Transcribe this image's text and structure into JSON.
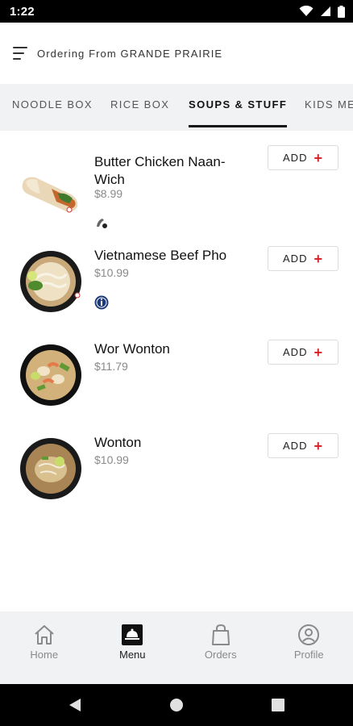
{
  "status_bar": {
    "time": "1:22",
    "icons": [
      "wifi-icon",
      "signal-icon",
      "battery-icon"
    ]
  },
  "header": {
    "menu_icon": "menu-icon",
    "title": "Ordering From GRANDE PRAIRIE"
  },
  "tabs": [
    {
      "label": "NOODLE BOX",
      "active": false
    },
    {
      "label": "RICE BOX",
      "active": false
    },
    {
      "label": "SOUPS & STUFF",
      "active": true
    },
    {
      "label": "KIDS ME",
      "active": false
    }
  ],
  "items": [
    {
      "name": "Butter Chicken Naan-Wich",
      "price": "$8.99",
      "add_label": "ADD",
      "badge": "spicy-mild-icon"
    },
    {
      "name": "Vietnamese Beef Pho",
      "price": "$10.99",
      "add_label": "ADD",
      "badge": "info-badge-icon"
    },
    {
      "name": "Wor Wonton",
      "price": "$11.79",
      "add_label": "ADD"
    },
    {
      "name": "Wonton",
      "price": "$10.99",
      "add_label": "ADD"
    }
  ],
  "bottom_nav": [
    {
      "label": "Home",
      "icon": "home-icon",
      "active": false
    },
    {
      "label": "Menu",
      "icon": "menu-tab-icon",
      "active": true
    },
    {
      "label": "Orders",
      "icon": "shopping-bag-icon",
      "active": false
    },
    {
      "label": "Profile",
      "icon": "profile-icon",
      "active": false
    }
  ],
  "colors": {
    "accent_red": "#d5262b",
    "tab_bar_bg": "#f1f2f4",
    "price_gray": "#8a8a8a"
  }
}
